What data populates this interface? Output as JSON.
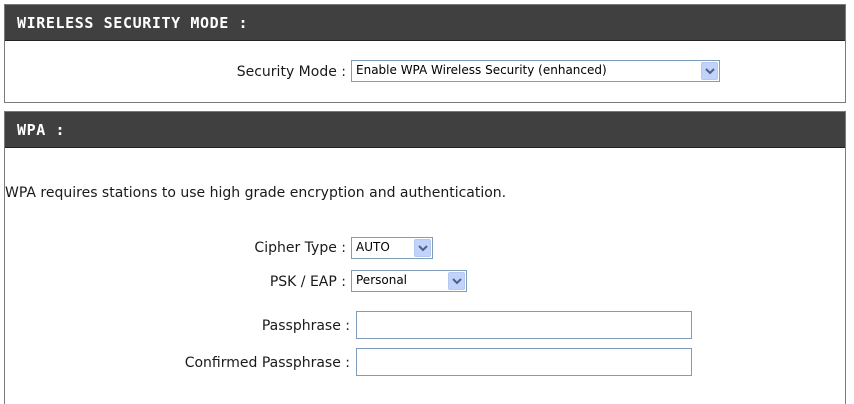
{
  "security_mode_section": {
    "title": "WIRELESS SECURITY MODE :",
    "label": "Security Mode :",
    "selected": "Enable WPA Wireless Security (enhanced)"
  },
  "wpa_section": {
    "title": "WPA :",
    "description": "WPA requires stations to use high grade encryption and authentication.",
    "cipher_type": {
      "label": "Cipher Type :",
      "selected": "AUTO"
    },
    "psk_eap": {
      "label": "PSK / EAP :",
      "selected": "Personal"
    },
    "passphrase": {
      "label": "Passphrase :",
      "value": ""
    },
    "confirmed_passphrase": {
      "label": "Confirmed Passphrase :",
      "value": ""
    }
  },
  "icons": {
    "dropdown_arrow": "chevron-down-icon"
  },
  "colors": {
    "header_bg": "#404040",
    "header_text": "#ffffff",
    "dropdown_button": "#c1d3fb",
    "input_border": "#7f9db9"
  }
}
